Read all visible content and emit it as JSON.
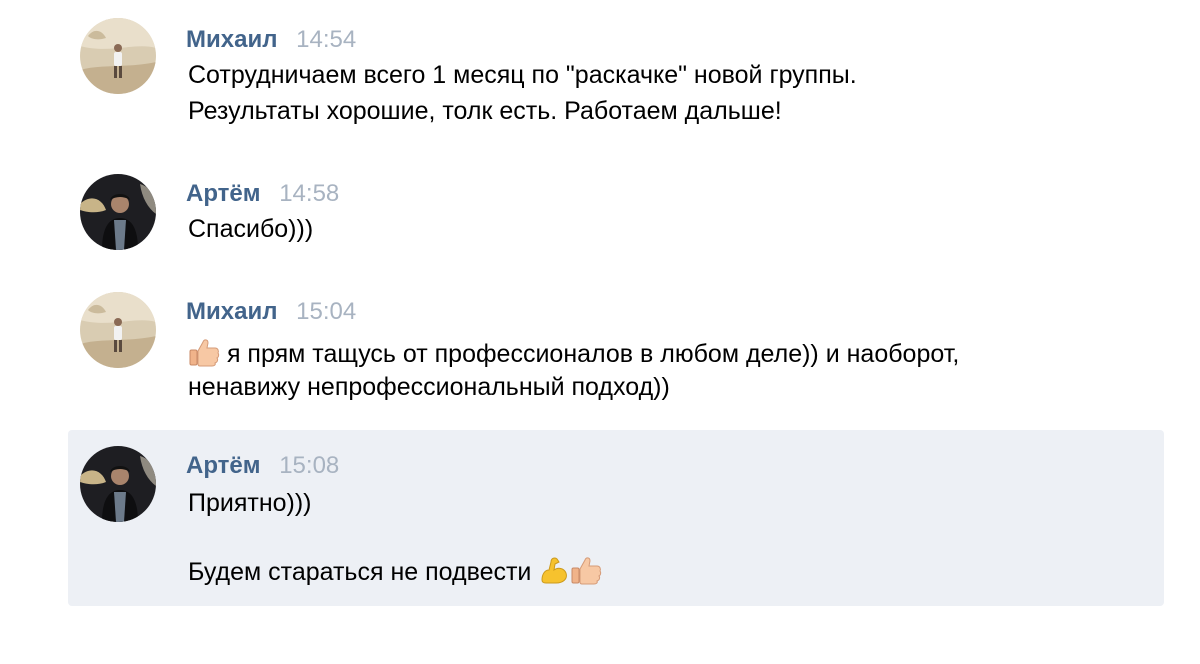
{
  "messages": [
    {
      "author": "Михаил",
      "time": "14:54",
      "lines": [
        "Сотрудничаем всего 1 месяц по \"раскачке\" новой группы.",
        "Результаты хорошие, толк есть. Работаем дальше!"
      ]
    },
    {
      "author": "Артём",
      "time": "14:58",
      "lines": [
        "Спасибо)))"
      ]
    },
    {
      "author": "Михаил",
      "time": "15:04",
      "lines": [
        "я прям тащусь от профессионалов в любом деле)) и наоборот,",
        "ненавижу непрофессиональный подход))"
      ]
    },
    {
      "author": "Артём",
      "time": "15:08",
      "lines": [
        "Приятно)))",
        "Будем стараться не подвести"
      ]
    }
  ],
  "icons": {
    "avatar_mikhail": "avatar-beach-photo",
    "avatar_artem": "avatar-dark-photo",
    "thumbs_up": "thumbs-up-emoji",
    "flexed_biceps": "flexed-biceps-emoji"
  },
  "colors": {
    "author": "#42648b",
    "time": "#a8b3c1",
    "highlight_bg": "#edf0f5"
  }
}
